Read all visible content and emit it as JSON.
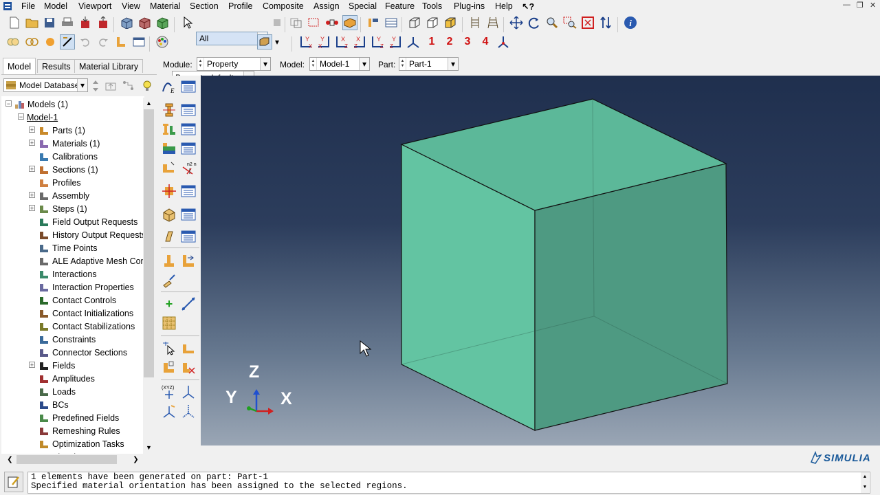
{
  "menu": [
    "File",
    "Model",
    "Viewport",
    "View",
    "Material",
    "Section",
    "Profile",
    "Composite",
    "Assign",
    "Special",
    "Feature",
    "Tools",
    "Plug-ins",
    "Help",
    "↖?"
  ],
  "toolbar": {
    "selection_filter": "All",
    "render_style": "Property defaults",
    "view_numbers": [
      "1",
      "2",
      "3",
      "4"
    ]
  },
  "context": {
    "module_label": "Module:",
    "module_value": "Property",
    "model_label": "Model:",
    "model_value": "Model-1",
    "part_label": "Part:",
    "part_value": "Part-1"
  },
  "tabs": [
    "Model",
    "Results",
    "Material Library"
  ],
  "database_combo": "Model Database",
  "tree": {
    "root": "Models (1)",
    "model": "Model-1",
    "items": [
      {
        "label": "Parts (1)",
        "expandable": true
      },
      {
        "label": "Materials (1)",
        "expandable": true
      },
      {
        "label": "Calibrations",
        "expandable": false
      },
      {
        "label": "Sections (1)",
        "expandable": true
      },
      {
        "label": "Profiles",
        "expandable": false
      },
      {
        "label": "Assembly",
        "expandable": true
      },
      {
        "label": "Steps (1)",
        "expandable": true
      },
      {
        "label": "Field Output Requests",
        "expandable": false
      },
      {
        "label": "History Output Requests",
        "expandable": false
      },
      {
        "label": "Time Points",
        "expandable": false
      },
      {
        "label": "ALE Adaptive Mesh Cons",
        "expandable": false
      },
      {
        "label": "Interactions",
        "expandable": false
      },
      {
        "label": "Interaction Properties",
        "expandable": false
      },
      {
        "label": "Contact Controls",
        "expandable": false
      },
      {
        "label": "Contact Initializations",
        "expandable": false
      },
      {
        "label": "Contact Stabilizations",
        "expandable": false
      },
      {
        "label": "Constraints",
        "expandable": false
      },
      {
        "label": "Connector Sections",
        "expandable": false
      },
      {
        "label": "Fields",
        "expandable": true
      },
      {
        "label": "Amplitudes",
        "expandable": false
      },
      {
        "label": "Loads",
        "expandable": false
      },
      {
        "label": "BCs",
        "expandable": false
      },
      {
        "label": "Predefined Fields",
        "expandable": false
      },
      {
        "label": "Remeshing Rules",
        "expandable": false
      },
      {
        "label": "Optimization Tasks",
        "expandable": false
      },
      {
        "label": "Sketches",
        "expandable": false
      }
    ]
  },
  "triad": {
    "z": "Z",
    "y": "Y",
    "x": "X"
  },
  "brand": "SIMULIA",
  "messages": [
    "1 elements have been generated on part: Part-1",
    "Specified material orientation has been assigned to the selected regions."
  ],
  "colors": {
    "cube_front": "#63c4a2",
    "cube_side": "#4e9a82",
    "cube_top": "#5cb899",
    "accent_red": "#d01010"
  }
}
